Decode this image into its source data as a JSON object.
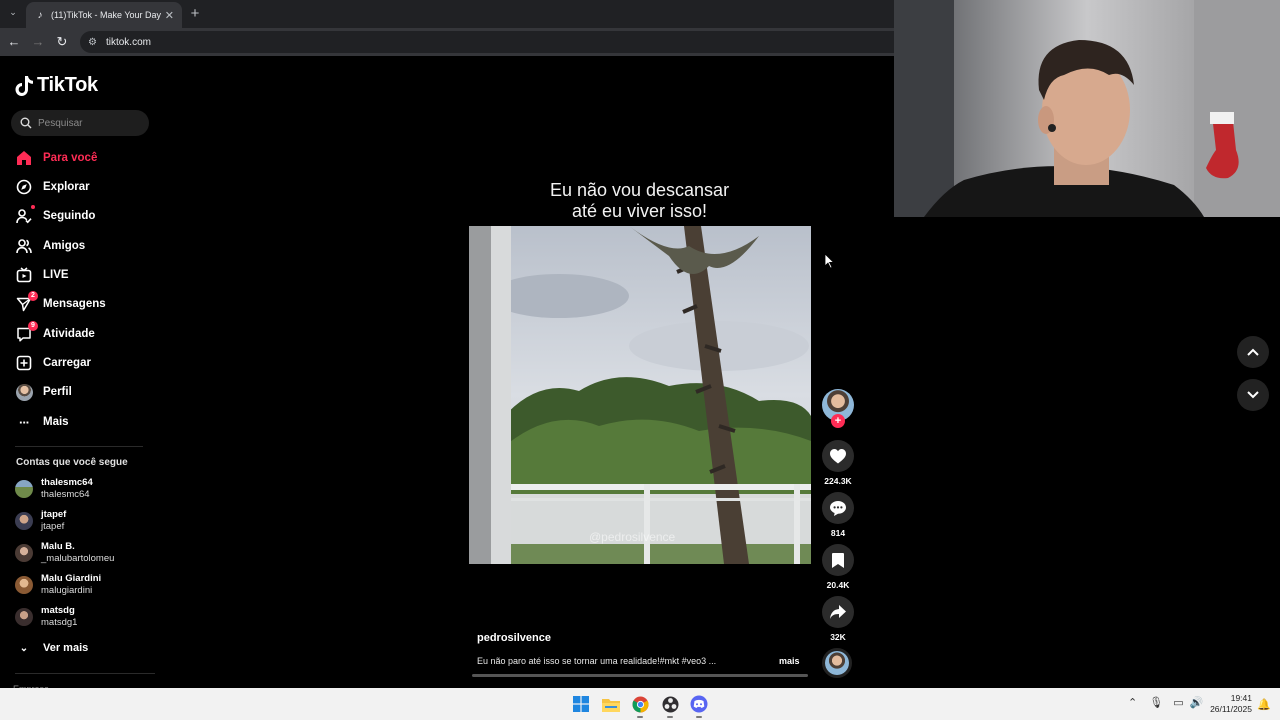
{
  "browser": {
    "tab_title": "(11)TikTok - Make Your Day",
    "url": "tiktok.com"
  },
  "sidebar": {
    "logo_text": "TikTok",
    "search_placeholder": "Pesquisar",
    "nav": [
      {
        "label": "Para você",
        "icon": "home-icon",
        "active": true
      },
      {
        "label": "Explorar",
        "icon": "compass-icon"
      },
      {
        "label": "Seguindo",
        "icon": "following-icon"
      },
      {
        "label": "Amigos",
        "icon": "friends-icon"
      },
      {
        "label": "LIVE",
        "icon": "live-icon"
      },
      {
        "label": "Mensagens",
        "icon": "messages-icon",
        "badge": "2"
      },
      {
        "label": "Atividade",
        "icon": "activity-icon",
        "badge": "9"
      },
      {
        "label": "Carregar",
        "icon": "upload-icon"
      },
      {
        "label": "Perfil",
        "icon": "profile-avatar"
      },
      {
        "label": "Mais",
        "icon": "more-icon"
      }
    ],
    "following_title": "Contas que você segue",
    "accounts": [
      {
        "name": "thalesmc64",
        "handle": "thalesmc64"
      },
      {
        "name": "jtapef",
        "handle": "jtapef"
      },
      {
        "name": "Malu B.",
        "handle": "_malubartolomeu"
      },
      {
        "name": "Malu Giardini",
        "handle": "malugiardini"
      },
      {
        "name": "matsdg",
        "handle": "matsdg1"
      }
    ],
    "see_more": "Ver mais",
    "footer_label": "Empresa"
  },
  "video": {
    "title_line1": "Eu não vou descansar",
    "title_line2": "até eu viver isso!",
    "watermark": "@pedrosilvence",
    "author": "pedrosilvence",
    "caption": "Eu não paro até isso se tornar uma realidade!#mkt #veo3 ...",
    "more_label": "mais"
  },
  "actions": {
    "likes": "224.3K",
    "comments": "814",
    "saves": "20.4K",
    "shares": "32K"
  },
  "colors": {
    "accent": "#fe2c55",
    "background": "#000000",
    "taskbar": "#f2f2f2"
  },
  "taskbar": {
    "time": "19:41",
    "date": "26/11/2025",
    "apps": [
      "windows-start-icon",
      "file-explorer-icon",
      "chrome-icon",
      "obs-icon",
      "discord-icon"
    ]
  }
}
